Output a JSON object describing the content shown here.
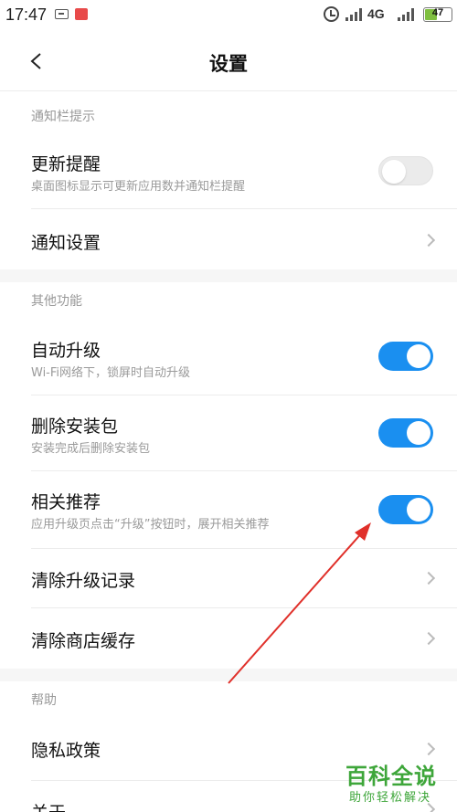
{
  "status_bar": {
    "time": "17:47",
    "network": "4G",
    "battery": "47",
    "battery_level": 0.47,
    "icons": [
      "sim-icon",
      "notification-icon",
      "alarm-icon",
      "signal-icon",
      "signal-icon"
    ]
  },
  "header": {
    "title": "设置",
    "back_icon": "chevron-left-icon"
  },
  "sections": [
    {
      "header": "通知栏提示",
      "items": [
        {
          "title": "更新提醒",
          "subtitle": "桌面图标显示可更新应用数并通知栏提醒",
          "control": "toggle",
          "on": false
        },
        {
          "title": "通知设置",
          "control": "chevron"
        }
      ]
    },
    {
      "header": "其他功能",
      "items": [
        {
          "title": "自动升级",
          "subtitle": "Wi-Fi网络下，锁屏时自动升级",
          "control": "toggle",
          "on": true
        },
        {
          "title": "删除安装包",
          "subtitle": "安装完成后删除安装包",
          "control": "toggle",
          "on": true
        },
        {
          "title": "相关推荐",
          "subtitle": "应用升级页点击“升级”按钮时，展开相关推荐",
          "control": "toggle",
          "on": true
        },
        {
          "title": "清除升级记录",
          "control": "chevron"
        },
        {
          "title": "清除商店缓存",
          "control": "chevron"
        }
      ]
    },
    {
      "header": "帮助",
      "items": [
        {
          "title": "隐私政策",
          "control": "chevron"
        },
        {
          "title": "关于",
          "control": "chevron"
        }
      ]
    }
  ],
  "watermark": {
    "main": "百科全说",
    "sub": "助你轻松解决"
  },
  "colors": {
    "accent": "#1a8ff0",
    "annotation_arrow": "#e0302a",
    "watermark": "#3ea63a",
    "section_gap": "#f6f6f6"
  }
}
